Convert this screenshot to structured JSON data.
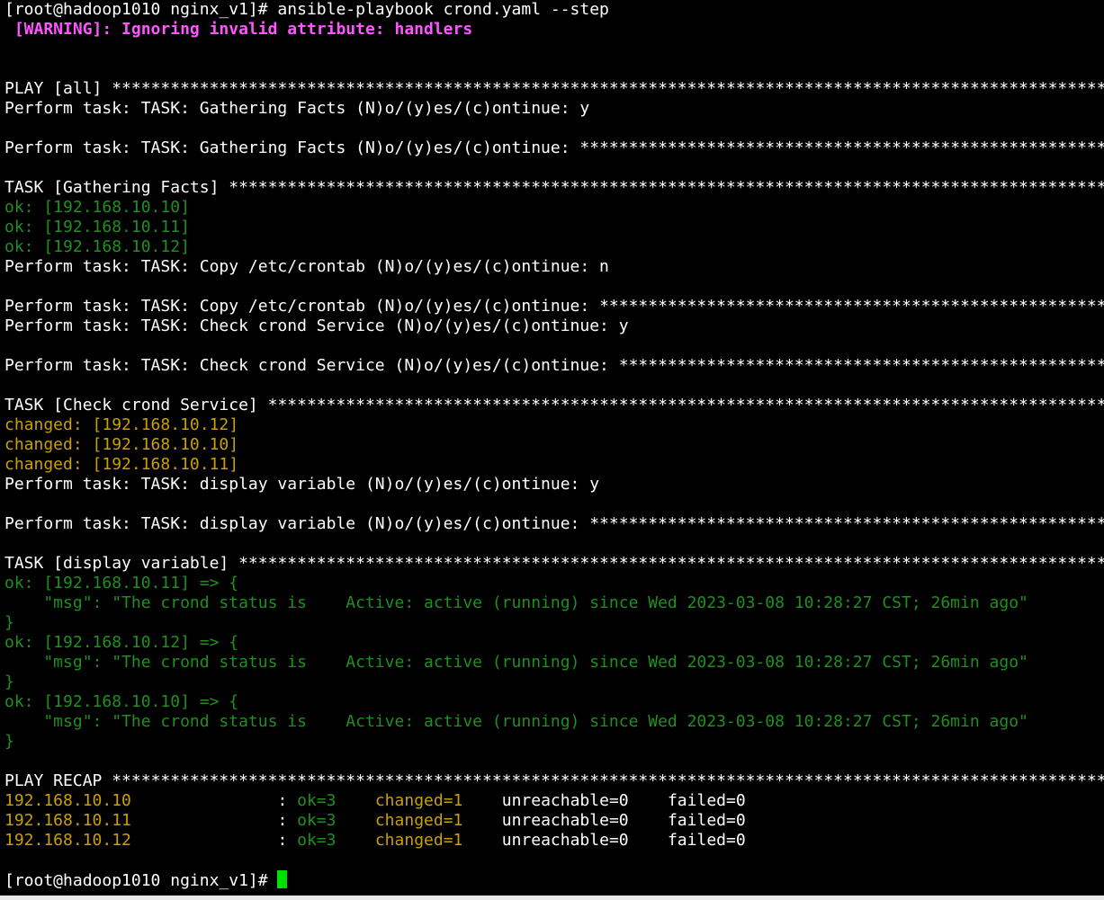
{
  "stars": "************************************************************************************************************************************************************",
  "terminal": {
    "l01": "[root@hadoop1010 nginx_v1]# ansible-playbook crond.yaml --step",
    "l02": " [WARNING]: Ignoring invalid attribute: handlers",
    "l05": "PLAY [all] ",
    "l06": "Perform task: TASK: Gathering Facts (N)o/(y)es/(c)ontinue: y",
    "l08": "Perform task: TASK: Gathering Facts (N)o/(y)es/(c)ontinue: ",
    "l10": "TASK [Gathering Facts] ",
    "l11": "ok: [192.168.10.10]",
    "l12": "ok: [192.168.10.11]",
    "l13": "ok: [192.168.10.12]",
    "l14": "Perform task: TASK: Copy /etc/crontab (N)o/(y)es/(c)ontinue: n",
    "l16": "Perform task: TASK: Copy /etc/crontab (N)o/(y)es/(c)ontinue: ",
    "l17": "Perform task: TASK: Check crond Service (N)o/(y)es/(c)ontinue: y",
    "l19": "Perform task: TASK: Check crond Service (N)o/(y)es/(c)ontinue: ",
    "l21": "TASK [Check crond Service] ",
    "l22": "changed: [192.168.10.12]",
    "l23": "changed: [192.168.10.10]",
    "l24": "changed: [192.168.10.11]",
    "l25": "Perform task: TASK: display variable (N)o/(y)es/(c)ontinue: y",
    "l27": "Perform task: TASK: display variable (N)o/(y)es/(c)ontinue: ",
    "l29": "TASK [display variable] ",
    "l30": "ok: [192.168.10.11] => {",
    "l31": "    \"msg\": \"The crond status is    Active: active (running) since Wed 2023-03-08 10:28:27 CST; 26min ago\"",
    "l32": "}",
    "l33": "ok: [192.168.10.12] => {",
    "l34": "    \"msg\": \"The crond status is    Active: active (running) since Wed 2023-03-08 10:28:27 CST; 26min ago\"",
    "l35": "}",
    "l36": "ok: [192.168.10.10] => {",
    "l37": "    \"msg\": \"The crond status is    Active: active (running) since Wed 2023-03-08 10:28:27 CST; 26min ago\"",
    "l38": "}",
    "l40": "PLAY RECAP ",
    "recap": [
      {
        "host": "192.168.10.10",
        "sep": "               : ",
        "ok": "ok=3",
        "gap1": "    ",
        "changed": "changed=1",
        "rest": "    unreachable=0    failed=0"
      },
      {
        "host": "192.168.10.11",
        "sep": "               : ",
        "ok": "ok=3",
        "gap1": "    ",
        "changed": "changed=1",
        "rest": "    unreachable=0    failed=0"
      },
      {
        "host": "192.168.10.12",
        "sep": "               : ",
        "ok": "ok=3",
        "gap1": "    ",
        "changed": "changed=1",
        "rest": "    unreachable=0    failed=0"
      }
    ],
    "prompt": "[root@hadoop1010 nginx_v1]# "
  },
  "colors": {
    "background": "#000000",
    "text": "#ffffff",
    "warning": "#ff55ff",
    "ok": "#1f8f1f",
    "changed": "#c8a000",
    "cursor": "#00e000"
  }
}
